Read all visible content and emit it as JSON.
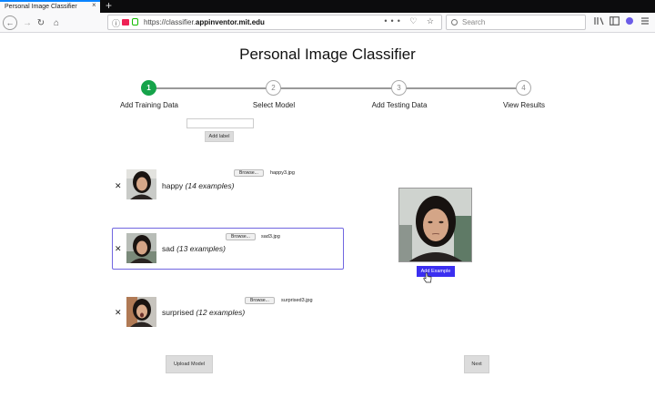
{
  "browser": {
    "tab_title": "Personal Image Classifier",
    "tab_close": "×",
    "new_tab": "+",
    "url_prefix": "https://classifier.",
    "url_domain": "appinventor.mit.edu",
    "url_actions": "••• ♡ ☆",
    "search_placeholder": "Search"
  },
  "page": {
    "title": "Personal Image Classifier",
    "steps": [
      {
        "number": "1",
        "label": "Add Training Data"
      },
      {
        "number": "2",
        "label": "Select Model"
      },
      {
        "number": "3",
        "label": "Add Testing Data"
      },
      {
        "number": "4",
        "label": "View Results"
      }
    ],
    "active_step": 1,
    "add_label_button": "Add label",
    "label_input_value": "",
    "rows": [
      {
        "name": "happy",
        "examples": "(14 examples)",
        "browse": "Browse...",
        "file": "happy3.jpg",
        "remove": "✕"
      },
      {
        "name": "sad",
        "examples": "(13 examples)",
        "browse": "Browse...",
        "file": "sad3.jpg",
        "remove": "✕"
      },
      {
        "name": "surprised",
        "examples": "(12 examples)",
        "browse": "Browse...",
        "file": "surprised3.jpg",
        "remove": "✕"
      }
    ],
    "selected_row": "sad",
    "add_example_button": "Add Example",
    "upload_model_button": "Upload Model",
    "next_button": "Next"
  },
  "colors": {
    "active_step": "#16a34a",
    "selected_border": "#7066e0",
    "primary_button": "#3b2ff0"
  }
}
